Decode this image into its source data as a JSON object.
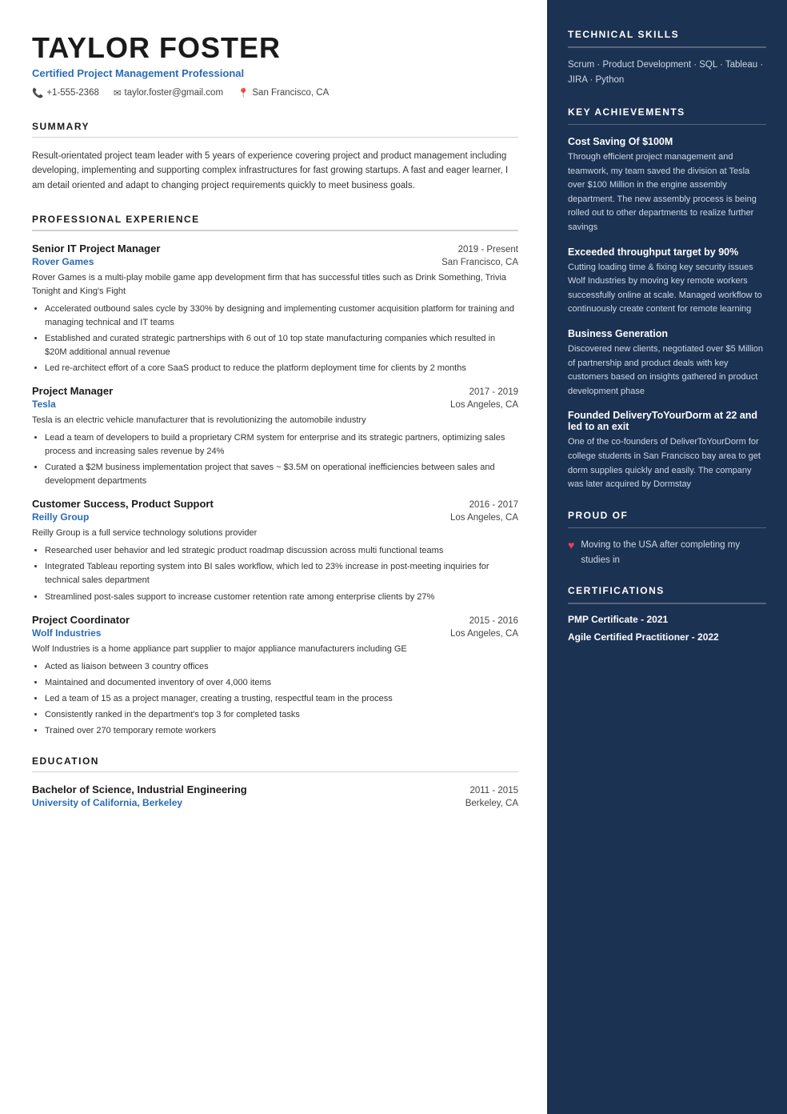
{
  "header": {
    "name": "TAYLOR FOSTER",
    "title": "Certified Project Management Professional",
    "phone": "+1-555-2368",
    "email": "taylor.foster@gmail.com",
    "location": "San Francisco, CA"
  },
  "summary": {
    "section_title": "SUMMARY",
    "text": "Result-orientated project team leader with 5 years of experience covering project and product management including developing, implementing and supporting complex infrastructures for fast growing startups. A fast and eager learner, I am detail oriented and adapt to changing project requirements quickly to meet business goals."
  },
  "experience": {
    "section_title": "PROFESSIONAL EXPERIENCE",
    "jobs": [
      {
        "title": "Senior IT Project Manager",
        "dates": "2019 - Present",
        "company": "Rover Games",
        "location": "San Francisco, CA",
        "description": "Rover Games is a multi-play mobile game app development firm that has successful titles such as Drink Something, Trivia Tonight and King's Fight",
        "bullets": [
          "Accelerated outbound sales cycle by 330% by designing and implementing customer acquisition platform for training and managing technical and IT teams",
          "Established and curated strategic partnerships with 6 out of 10 top state manufacturing companies which resulted in $20M additional annual revenue",
          "Led re-architect effort of a core SaaS product to reduce the platform deployment time for clients by 2 months"
        ]
      },
      {
        "title": "Project Manager",
        "dates": "2017 - 2019",
        "company": "Tesla",
        "location": "Los Angeles, CA",
        "description": "Tesla is an electric vehicle manufacturer that is revolutionizing the automobile industry",
        "bullets": [
          "Lead a team of developers to build a proprietary CRM system for enterprise and its strategic partners, optimizing sales process and increasing sales revenue by 24%",
          "Curated a $2M business implementation project that saves ~ $3.5M on operational inefficiencies between sales and development departments"
        ]
      },
      {
        "title": "Customer Success, Product Support",
        "dates": "2016 - 2017",
        "company": "Reilly Group",
        "location": "Los Angeles, CA",
        "description": "Reilly Group is a full service technology solutions provider",
        "bullets": [
          "Researched user behavior and led strategic product roadmap discussion across multi functional teams",
          "Integrated Tableau reporting system into BI sales workflow, which led to 23% increase in post-meeting inquiries for technical sales department",
          "Streamlined post-sales support to increase customer retention rate among enterprise clients by 27%"
        ]
      },
      {
        "title": "Project Coordinator",
        "dates": "2015 - 2016",
        "company": "Wolf Industries",
        "location": "Los Angeles, CA",
        "description": "Wolf Industries is a home appliance part supplier to major appliance manufacturers including GE",
        "bullets": [
          "Acted as liaison between 3 country offices",
          "Maintained and documented inventory of over 4,000 items",
          "Led a team of 15 as a project manager, creating a trusting, respectful team in the process",
          "Consistently ranked in the department's top 3 for completed tasks",
          "Trained over 270 temporary remote workers"
        ]
      }
    ]
  },
  "education": {
    "section_title": "EDUCATION",
    "degree": "Bachelor of Science, Industrial Engineering",
    "dates": "2011 - 2015",
    "school": "University of California, Berkeley",
    "location": "Berkeley, CA"
  },
  "right": {
    "technical_skills": {
      "section_title": "TECHNICAL SKILLS",
      "text": "Scrum · Product Development · SQL · Tableau · JIRA · Python"
    },
    "key_achievements": {
      "section_title": "KEY ACHIEVEMENTS",
      "items": [
        {
          "title": "Cost Saving Of $100M",
          "text": "Through efficient project management and teamwork, my team saved the division at Tesla over $100 Million in the engine assembly department. The new assembly process is being rolled out to other departments to realize further savings"
        },
        {
          "title": "Exceeded throughput target by 90%",
          "text": "Cutting loading time & fixing key security issues Wolf Industries by moving key remote workers successfully online at scale. Managed workflow to continuously create content for remote learning"
        },
        {
          "title": "Business Generation",
          "text": "Discovered new clients, negotiated over $5 Million of partnership and product deals with key customers based on insights gathered in product development phase"
        },
        {
          "title": "Founded DeliveryToYourDorm at 22 and led to an exit",
          "text": "One of the co-founders of DeliverToYourDorm for college students in San Francisco bay area to get dorm supplies quickly and easily. The company was later acquired by Dormstay"
        }
      ]
    },
    "proud_of": {
      "section_title": "PROUD OF",
      "items": [
        {
          "icon": "♥",
          "text": "Moving to the USA after completing my studies in"
        }
      ]
    },
    "certifications": {
      "section_title": "CERTIFICATIONS",
      "items": [
        "PMP Certificate - 2021",
        "Agile Certified Practitioner - 2022"
      ]
    }
  }
}
